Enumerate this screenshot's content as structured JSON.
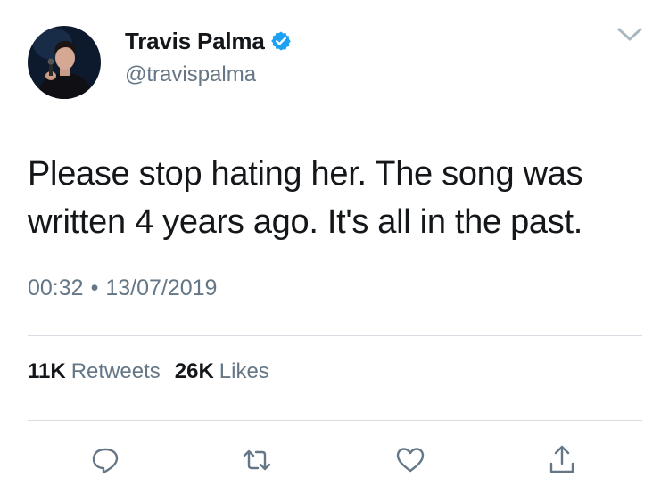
{
  "user": {
    "display_name": "Travis Palma",
    "handle": "@travispalma",
    "verified": true,
    "avatar_icon": "profile-photo"
  },
  "tweet": {
    "text": "Please stop hating her. The song was\nwritten 4 years ago. It's all in the past.",
    "time": "00:32",
    "separator": "•",
    "date": "13/07/2019"
  },
  "stats": {
    "retweets_count": "11K",
    "retweets_label": "Retweets",
    "likes_count": "26K",
    "likes_label": "Likes"
  },
  "actions": [
    {
      "icon": "reply-icon"
    },
    {
      "icon": "retweet-icon"
    },
    {
      "icon": "like-icon"
    },
    {
      "icon": "share-icon"
    }
  ],
  "colors": {
    "primary_text": "#14171a",
    "secondary_text": "#657786",
    "verified_blue": "#1da1f2",
    "divider": "#d7dde2"
  }
}
